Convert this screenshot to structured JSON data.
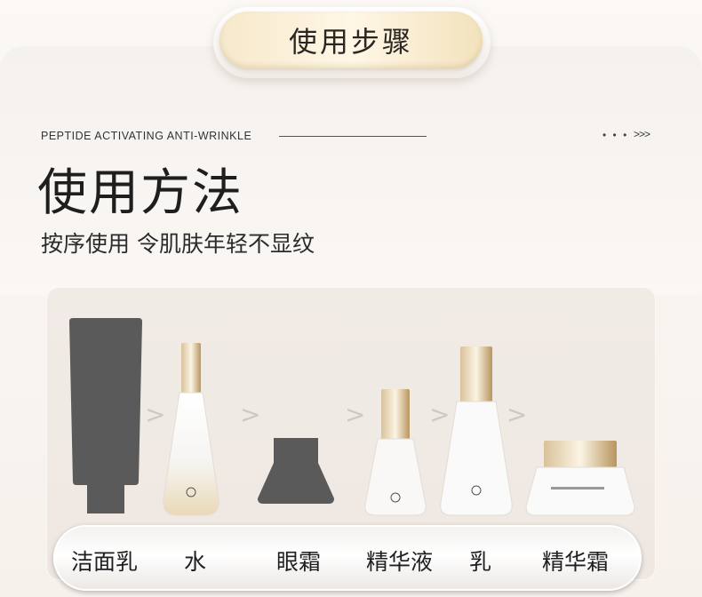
{
  "header": {
    "title": "使用步骤"
  },
  "intro": {
    "english_line": "PEPTIDE ACTIVATING ANTI-WRINKLE",
    "dots": "• • •",
    "chevrons": ">>>",
    "title": "使用方法",
    "subtitle": "按序使用 令肌肤年轻不显纹"
  },
  "steps": {
    "arrow": ">",
    "labels": [
      "洁面乳",
      "水",
      "眼霜",
      "精华液",
      "乳",
      "精华霜"
    ]
  },
  "colors": {
    "silhouette": "#5a5a5a",
    "cap_gold": "#c9a872",
    "bottle_glass": "#f6f4f2",
    "pill_gold": "#f3e2bd"
  }
}
